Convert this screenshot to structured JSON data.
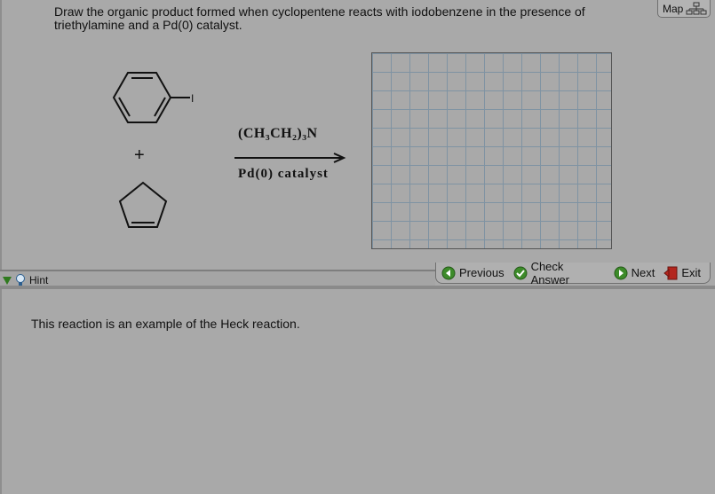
{
  "question": {
    "text": "Draw the organic product formed when cyclopentene reacts with iodobenzene in the presence of triethylamine and a Pd(0) catalyst."
  },
  "map_button": {
    "label": "Map",
    "icon": "sitemap-icon"
  },
  "reactants": {
    "iodo_label": "I",
    "plus": "+"
  },
  "reagents": {
    "top": "(CH₃CH₂)₃N",
    "bottom": "Pd(0) catalyst"
  },
  "hint": {
    "toggle_label": "Hint",
    "text": "This reaction is an example of the Heck reaction."
  },
  "nav": {
    "previous": "Previous",
    "check_answer": "Check Answer",
    "next": "Next",
    "exit": "Exit"
  },
  "colors": {
    "background": "#a9a9a9",
    "grid_line": "#7f93a3",
    "nav_green": "#3d8b2a",
    "exit_red": "#b3261e"
  }
}
